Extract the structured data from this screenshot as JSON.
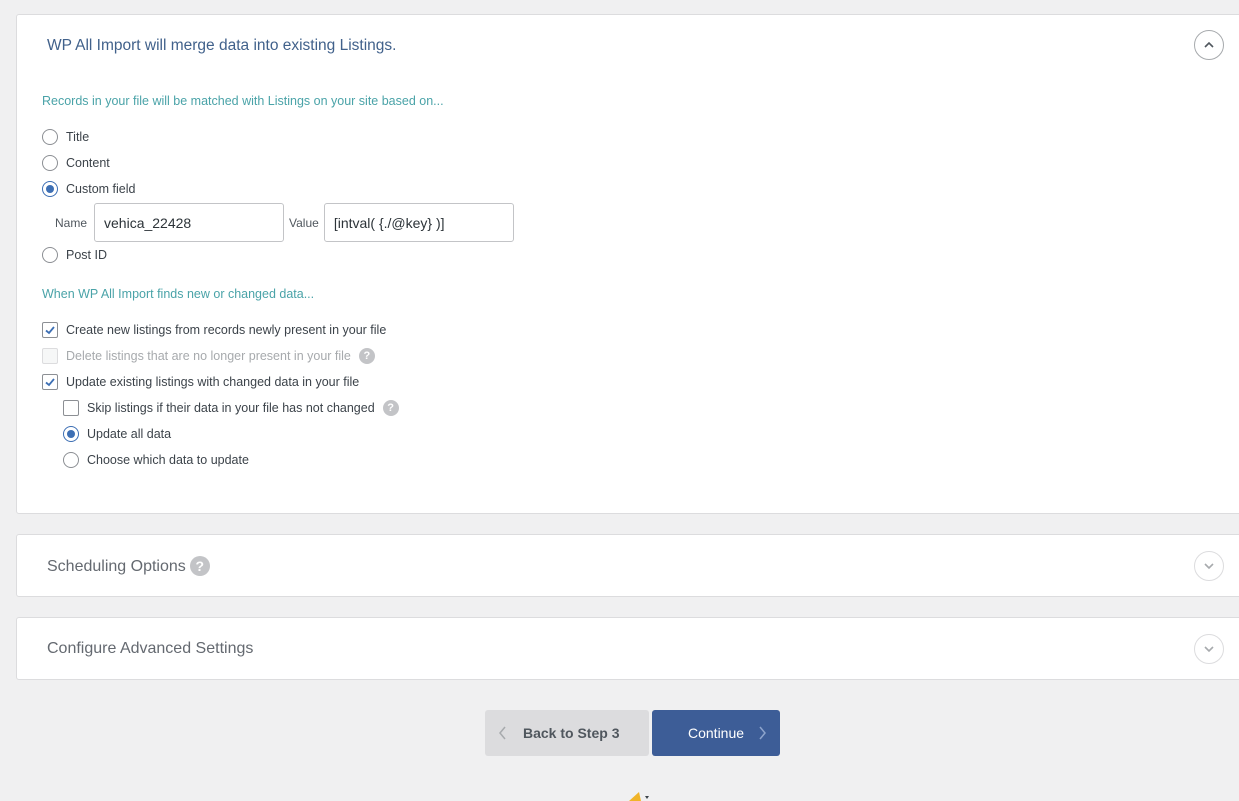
{
  "main_panel": {
    "title": "WP All Import will merge data into existing Listings.",
    "match_heading": "Records in your file will be matched with Listings on your site based on...",
    "match_options": {
      "title": "Title",
      "content": "Content",
      "custom_field": "Custom field",
      "post_id": "Post ID"
    },
    "selected_match": "Custom field",
    "custom_field": {
      "name_label": "Name",
      "name_value": "vehica_22428",
      "value_label": "Value",
      "value_value": "[intval( {./@key} )]"
    },
    "data_heading": "When WP All Import finds new or changed data...",
    "create_new": {
      "label": "Create new listings from records newly present in your file",
      "checked": true
    },
    "delete_missing": {
      "label": "Delete listings that are no longer present in your file",
      "checked": false,
      "disabled": true
    },
    "update_existing": {
      "label": "Update existing listings with changed data in your file",
      "checked": true
    },
    "skip_unchanged": {
      "label": "Skip listings if their data in your file has not changed",
      "checked": false
    },
    "update_all": "Update all data",
    "choose_update": "Choose which data to update",
    "selected_update_mode": "Update all data"
  },
  "scheduling_panel": {
    "title": "Scheduling Options"
  },
  "advanced_panel": {
    "title": "Configure Advanced Settings"
  },
  "help_glyph": "?",
  "footer": {
    "back_label": "Back to Step 3",
    "continue_label": "Continue"
  },
  "colors": {
    "accent": "#3d5d97",
    "heading_teal": "#4aa3a8",
    "radio_checked": "#3d6fb4"
  }
}
